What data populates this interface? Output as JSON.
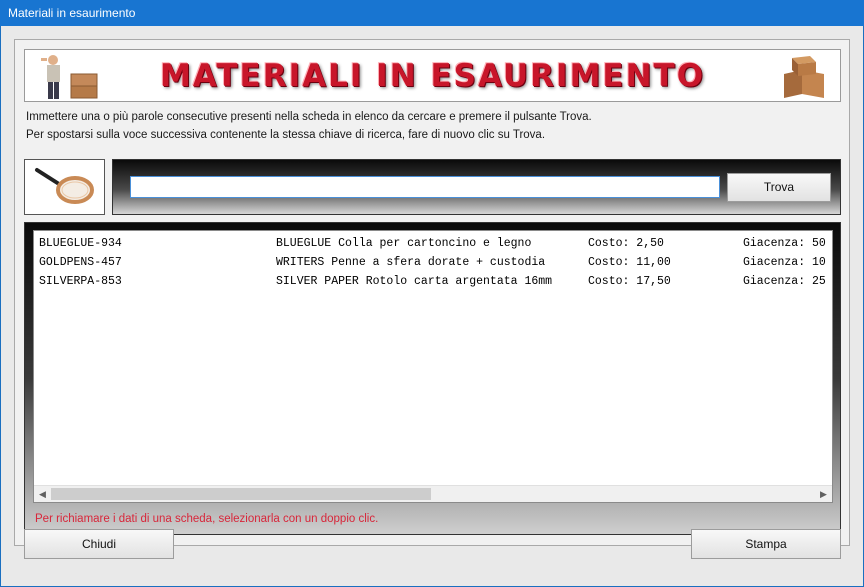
{
  "window": {
    "title": "Materiali in esaurimento"
  },
  "banner": {
    "title": "MATERIALI IN ESAURIMENTO"
  },
  "instructions": {
    "line1": "Immettere una o più parole consecutive presenti nella scheda in elenco da cercare e premere il pulsante Trova.",
    "line2": "Per spostarsi sulla voce successiva contenente la stessa chiave di ricerca, fare di nuovo clic su Trova."
  },
  "search": {
    "value": "",
    "button_label": "Trova"
  },
  "list": {
    "rows": [
      {
        "code": "BLUEGLUE-934",
        "description": "BLUEGLUE Colla per cartoncino e legno",
        "cost": "Costo: 2,50",
        "stock": "Giacenza: 50"
      },
      {
        "code": "GOLDPENS-457",
        "description": "WRITERS Penne a sfera dorate + custodia",
        "cost": "Costo: 11,00",
        "stock": "Giacenza: 10"
      },
      {
        "code": "SILVERPA-853",
        "description": "SILVER PAPER Rotolo carta argentata 16mm",
        "cost": "Costo: 17,50",
        "stock": "Giacenza: 25"
      }
    ],
    "hint": "Per richiamare i dati di una scheda, selezionarla con un doppio clic."
  },
  "footer": {
    "close_label": "Chiudi",
    "print_label": "Stampa"
  },
  "icons": {
    "scroll_left": "◀",
    "scroll_right": "▶"
  },
  "colors": {
    "titlebar": "#1875d1",
    "banner_text": "#c8162a",
    "hint_text": "#d8263a"
  }
}
